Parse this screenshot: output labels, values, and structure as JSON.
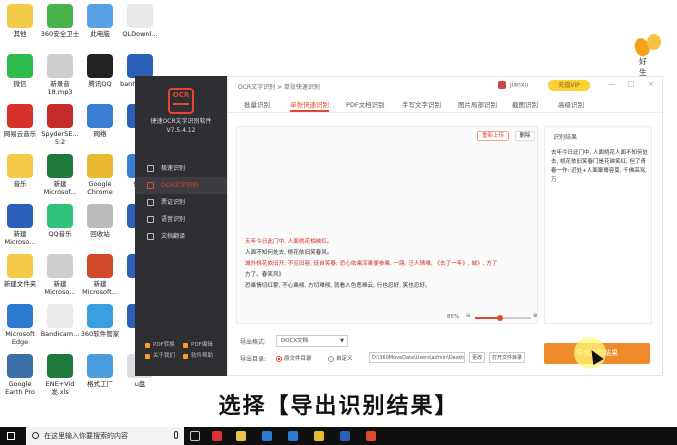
{
  "desktop": {
    "icons": [
      {
        "label": "其他",
        "color": "#f3c94a"
      },
      {
        "label": "360安全卫士",
        "color": "#46b34b"
      },
      {
        "label": "此电脑",
        "color": "#5aa0e6"
      },
      {
        "label": "QLDownl...",
        "color": "#e9e9e9"
      },
      {
        "label": "微信",
        "color": "#2dbb4e"
      },
      {
        "label": "新录音\n18.mp3",
        "color": "#cfcfcf"
      },
      {
        "label": "腾讯QQ",
        "color": "#222222"
      },
      {
        "label": "banhui.docx",
        "color": "#2b5fb8"
      },
      {
        "label": "网易云音乐",
        "color": "#d8322d"
      },
      {
        "label": "SpyderSE...\n5.2",
        "color": "#c62b2b"
      },
      {
        "label": "网络",
        "color": "#3a7fd5"
      },
      {
        "label": "Mi",
        "color": "#2b5fb8"
      },
      {
        "label": "音乐",
        "color": "#f3c94a"
      },
      {
        "label": "新建\nMicrosof...",
        "color": "#1f7a3e"
      },
      {
        "label": "Google\nChrome",
        "color": "#e8b931"
      },
      {
        "label": "保存",
        "color": "#3a7fd5"
      },
      {
        "label": "新建\nMicroso...",
        "color": "#2b5fb8"
      },
      {
        "label": "QQ音乐",
        "color": "#31c27c"
      },
      {
        "label": "回收站",
        "color": "#bbbbbb"
      },
      {
        "label": "Mi",
        "color": "#2b5fb8"
      },
      {
        "label": "新建文件夹",
        "color": "#f3c94a"
      },
      {
        "label": "新建\nMicroso...",
        "color": "#cfcfcf"
      },
      {
        "label": "新建\nMicrosoft...",
        "color": "#d04a2a"
      },
      {
        "label": "Mi",
        "color": "#2b5fb8"
      },
      {
        "label": "Microsoft\nEdge",
        "color": "#2b7bd1"
      },
      {
        "label": "Bandicam...",
        "color": "#eaeaea"
      },
      {
        "label": "360软件管家",
        "color": "#3aa0e0"
      },
      {
        "label": "Mi",
        "color": "#2b5fb8"
      },
      {
        "label": "Google\nEarth Pro",
        "color": "#3d6fa8"
      },
      {
        "label": "ENE+Vid\n发.xls",
        "color": "#1f7a3e"
      },
      {
        "label": "格式工厂",
        "color": "#4a9ee0"
      },
      {
        "label": "u盘",
        "color": "#dddddd"
      }
    ]
  },
  "corner_logo": {
    "text": "好 生"
  },
  "app": {
    "logo_text": "OCR",
    "name": "捷速OCR文字识别软件",
    "version": "V7.5.4.12",
    "nav": [
      {
        "label": "极速识别",
        "active": false
      },
      {
        "label": "OCR文字识别",
        "active": true
      },
      {
        "label": "票证识别",
        "active": false
      },
      {
        "label": "语音识别",
        "active": false
      },
      {
        "label": "文档翻译",
        "active": false
      }
    ],
    "footer_links": [
      "PDF转换",
      "PDF编辑",
      "关于我们",
      "软件帮助"
    ],
    "breadcrumb": "OCR文字识别 > 单张快速识别",
    "user_name": "jianxu",
    "vip_label": "充值VIP",
    "window_controls": [
      "—",
      "□",
      "×"
    ],
    "tabs": [
      {
        "label": "批量识别",
        "active": false
      },
      {
        "label": "单张快速识别",
        "active": true
      },
      {
        "label": "PDF文档识别",
        "active": false
      },
      {
        "label": "手写文字识别",
        "active": false
      },
      {
        "label": "图片局部识别",
        "active": false
      },
      {
        "label": "截图识别",
        "active": false
      },
      {
        "label": "高级识别",
        "active": false
      }
    ],
    "editor": {
      "reupload_label": "重新上传",
      "delete_label": "删除",
      "lines": [
        {
          "text": "天年今日此门中, 人面桃花相映红。",
          "red": true
        },
        {
          "text": "人面不知何处去, 桃花依旧笑春风。",
          "red": false
        },
        {
          "text": "城外桃花依旧开, 不见旧容, 徒自笑春; 恐心依乘凉乘便参乘, 一路; 汪人情难, 《去了一年》, 城》, 方了",
          "red": true
        },
        {
          "text": "方了。春笑风》",
          "red": false
        },
        {
          "text": "恐乘情切红雾, 不心乘候, 方切难候, 就看人色恶难云, 行也忍好, 笑也忍好。",
          "red": false
        }
      ],
      "zoom_label": "85%",
      "zoom_minus": "⊖",
      "zoom_plus": "⊕",
      "zoom_fraction": 0.45
    },
    "result": {
      "title": "识别结果",
      "text": "去年今日此门中, 人面桃花人面不知何处去, 桃花依旧笑春门是花映笑红, 但了青春一作: 近处+人面聚蓦容莫, 千佛高骂, 万"
    },
    "export": {
      "format_label": "导出格式:",
      "format_value": "DOCX文档",
      "dir_label": "导出目录:",
      "radio_source": "原文件目录",
      "radio_custom": "自定义",
      "path_value": "D:\\360MoveData\\Users\\admin\\Desktop\\",
      "change_label": "更改",
      "open_folder_label": "打开文件目录",
      "export_button_label": "导出识别结果"
    }
  },
  "caption": "选择【导出识别结果】",
  "taskbar": {
    "search_placeholder": "在这里输入你要搜索的内容"
  },
  "colors": {
    "accent": "#e2482e",
    "export_button": "#f08b2c",
    "sidebar": "#2f2f33"
  }
}
